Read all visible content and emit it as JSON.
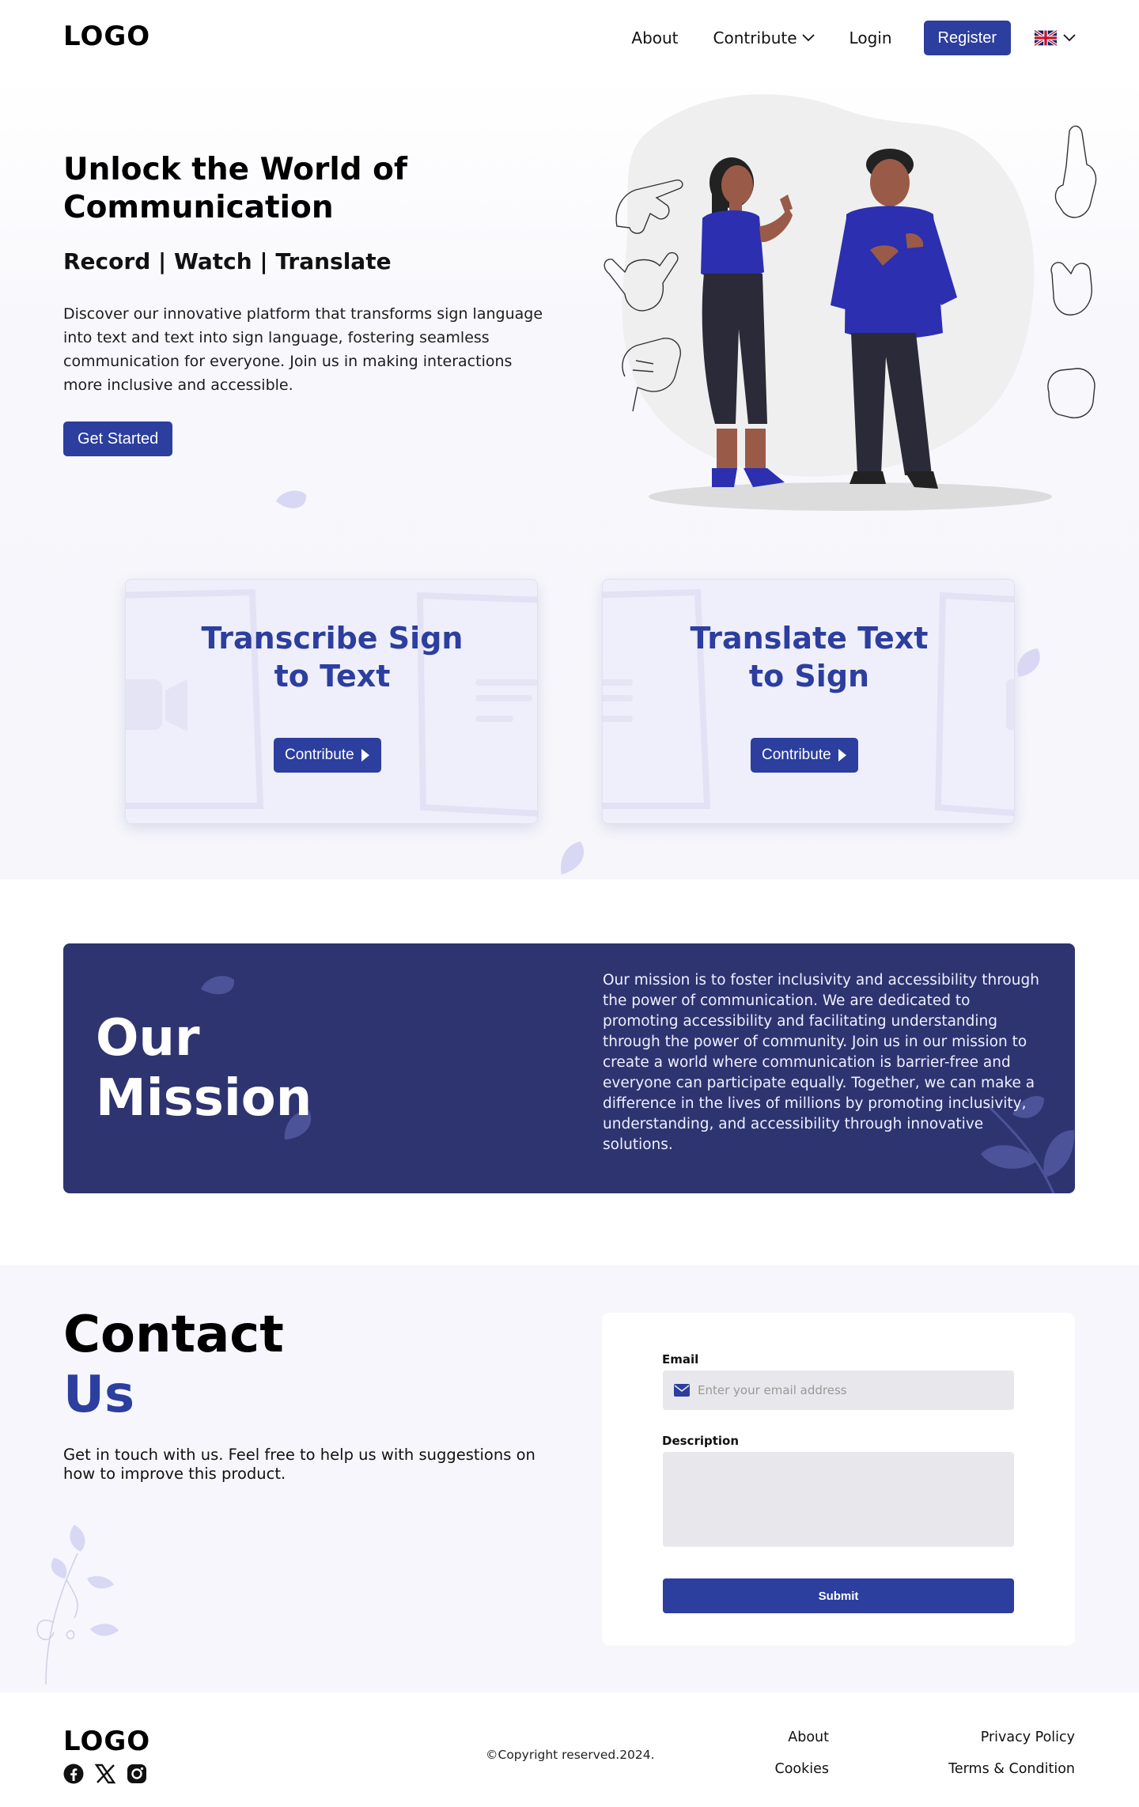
{
  "header": {
    "logo": "LOGO",
    "nav": {
      "about": "About",
      "contribute": "Contribute",
      "login": "Login",
      "register": "Register"
    },
    "language_icon": "uk-flag-icon"
  },
  "hero": {
    "title_line1": "Unlock the World of",
    "title_line2": "Communication",
    "subtitle": "Record | Watch | Translate",
    "description": "Discover our innovative platform that transforms sign language into text and text into sign language, fostering seamless communication for everyone. Join us in making interactions more inclusive and accessible.",
    "cta": "Get Started"
  },
  "cards": [
    {
      "title_line1": "Transcribe Sign",
      "title_line2": "to Text",
      "button": "Contribute"
    },
    {
      "title_line1": "Translate Text",
      "title_line2": "to Sign",
      "button": "Contribute"
    }
  ],
  "mission": {
    "title_line1": "Our",
    "title_line2": "Mission",
    "text": "Our mission is to foster inclusivity and accessibility through the power of communication. We are dedicated to promoting accessibility and facilitating understanding through the power of community. Join us in our mission to create a world where communication is barrier-free and everyone can participate equally. Together, we can make a difference in the lives of millions by promoting inclusivity, understanding, and accessibility through innovative solutions."
  },
  "contact": {
    "title_line1": "Contact",
    "title_line2": "Us",
    "text": "Get in touch with us. Feel free to help us with suggestions on how to improve this product.",
    "form": {
      "email_label": "Email",
      "email_placeholder": "Enter your email address",
      "email_value": "",
      "description_label": "Description",
      "description_value": "",
      "submit": "Submit"
    }
  },
  "footer": {
    "logo": "LOGO",
    "copyright": "©Copyright reserved.2024.",
    "links": {
      "about": "About",
      "privacy": "Privacy Policy",
      "cookies": "Cookies",
      "terms": "Terms & Condition"
    },
    "socials": [
      "facebook-icon",
      "x-icon",
      "instagram-icon"
    ]
  },
  "colors": {
    "accent": "#2c3e9e",
    "mission_bg": "#2e3470",
    "hero_bg": "#f6f6fb",
    "input_bg": "#e8e8ec"
  }
}
